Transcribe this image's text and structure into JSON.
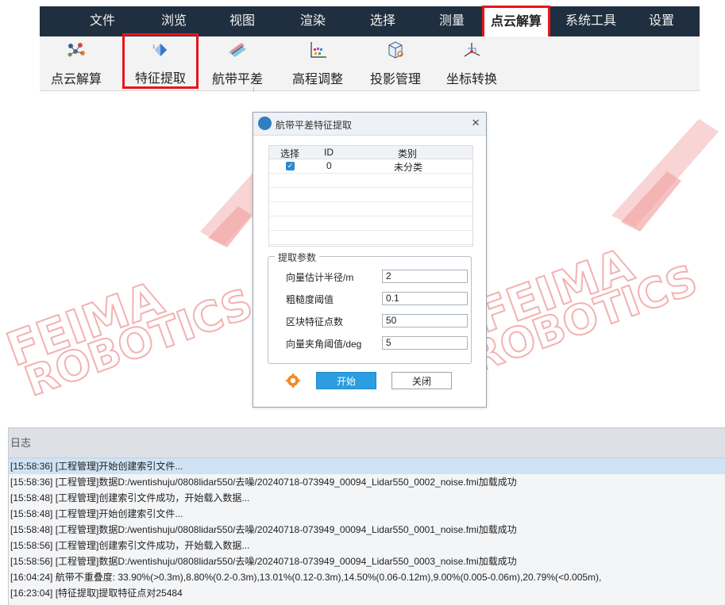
{
  "menu": {
    "items": [
      "文件",
      "浏览",
      "视图",
      "渲染",
      "选择",
      "测量",
      "点云解算",
      "系统工具",
      "设置"
    ],
    "active": "点云解算"
  },
  "toolbar": {
    "items": [
      {
        "label": "点云解算",
        "icon": "point-cloud-solve-icon"
      },
      {
        "label": "特征提取",
        "icon": "feature-extract-icon"
      },
      {
        "label": "航带平差",
        "icon": "strip-adjust-icon"
      },
      {
        "label": "高程调整",
        "icon": "elevation-adjust-icon"
      },
      {
        "label": "投影管理",
        "icon": "projection-manage-icon"
      },
      {
        "label": "坐标转换",
        "icon": "coordinate-convert-icon"
      }
    ],
    "active": "特征提取"
  },
  "watermark": {
    "line1": "FEIMA",
    "line2": "ROBOTICS",
    "color": "#f4b6b6"
  },
  "dialog": {
    "title": "航带平差特征提取",
    "close_glyph": "×",
    "table": {
      "headers": [
        "选择",
        "ID",
        "类别"
      ],
      "rows": [
        {
          "checked": true,
          "id": "0",
          "category": "未分类"
        }
      ]
    },
    "params": {
      "legend": "提取参数",
      "fields": [
        {
          "label": "向量估计半径/m",
          "value": "2"
        },
        {
          "label": "粗糙度阈值",
          "value": "0.1"
        },
        {
          "label": "区块特征点数",
          "value": "50"
        },
        {
          "label": "向量夹角阈值/deg",
          "value": "5"
        }
      ]
    },
    "start_label": "开始",
    "close_label": "关闭"
  },
  "log": {
    "title": "日志",
    "lines": [
      "[15:58:36] [工程管理]开始创建索引文件...",
      "[15:58:36] [工程管理]数据D:/wentishuju/0808lidar550/去噪/20240718-073949_00094_Lidar550_0002_noise.fmi加载成功",
      "[15:58:48] [工程管理]创建索引文件成功，开始载入数据...",
      "[15:58:48] [工程管理]开始创建索引文件...",
      "[15:58:48] [工程管理]数据D:/wentishuju/0808lidar550/去噪/20240718-073949_00094_Lidar550_0001_noise.fmi加载成功",
      "[15:58:56] [工程管理]创建索引文件成功，开始载入数据...",
      "[15:58:56] [工程管理]数据D:/wentishuju/0808lidar550/去噪/20240718-073949_00094_Lidar550_0003_noise.fmi加载成功",
      "[16:04:24] 航带不重叠度: 33.90%(>0.3m),8.80%(0.2-0.3m),13.01%(0.12-0.3m),14.50%(0.06-0.12m),9.00%(0.005-0.06m),20.79%(<0.005m),",
      "[16:23:04] [特征提取]提取特征点对25484"
    ],
    "selected_index": 0
  },
  "colors": {
    "menubar": "#1f2f3f",
    "highlight": "#e8151b",
    "primary_button": "#2b9de0"
  }
}
